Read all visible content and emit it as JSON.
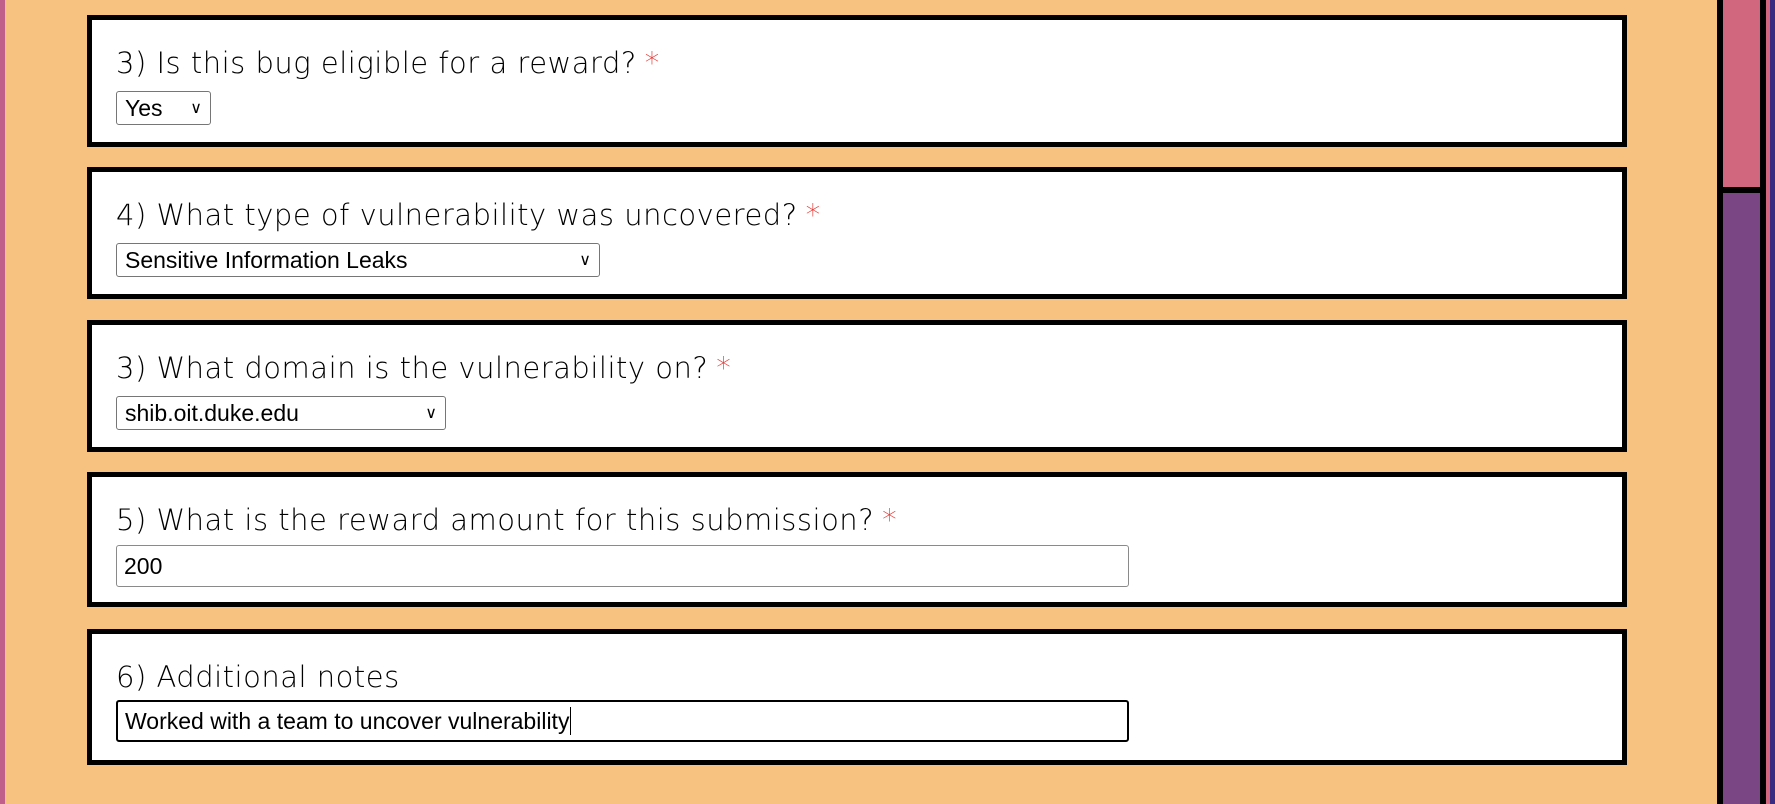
{
  "questions": [
    {
      "label": "3) Is this bug eligible for a reward?",
      "required": "*",
      "type": "select",
      "value": "Yes"
    },
    {
      "label": "4) What type of vulnerability was uncovered?",
      "required": "*",
      "type": "select",
      "value": "Sensitive Information Leaks"
    },
    {
      "label": "3) What domain is the vulnerability on?",
      "required": "*",
      "type": "select",
      "value": "shib.oit.duke.edu"
    },
    {
      "label": "5) What is the reward amount for this submission?",
      "required": "*",
      "type": "input",
      "value": "200"
    },
    {
      "label": "6) Additional notes",
      "type": "input",
      "value": "Worked with a team to uncover vulnerability"
    }
  ],
  "colors": {
    "background": "#f7c27f",
    "required": "#e53935",
    "sidebar_pink": "#d1677f",
    "sidebar_purple": "#7a4684"
  }
}
